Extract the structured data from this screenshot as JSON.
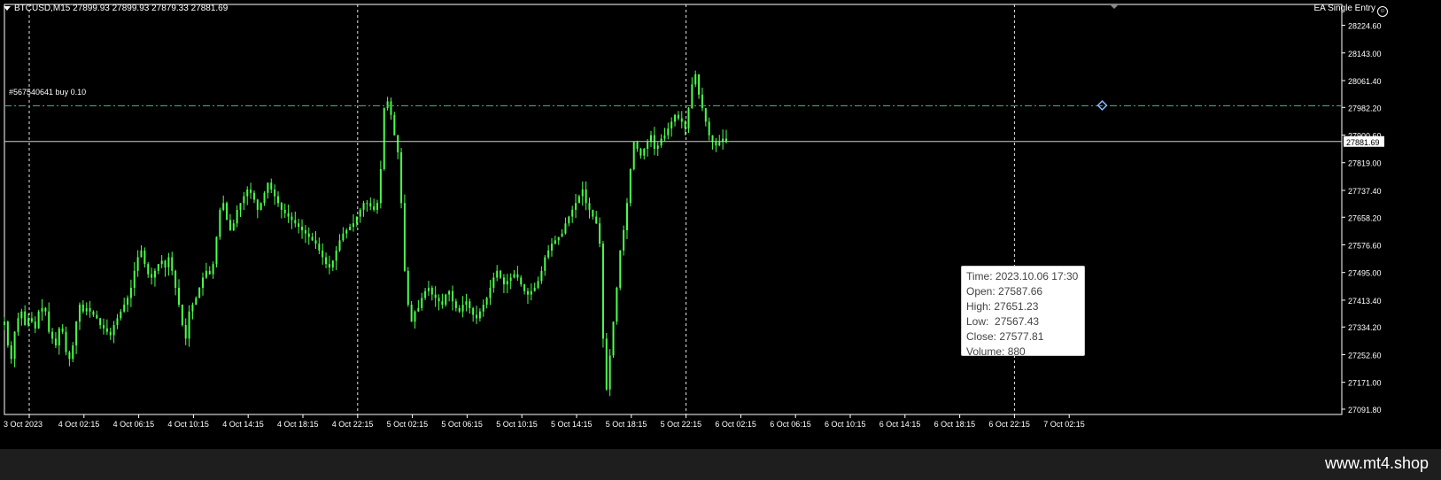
{
  "header": {
    "symbol_line": "BTCUSD,M15  27899.93 27899.93 27879.33 27881.69",
    "expert_label": "EA Single Entry"
  },
  "order_line": {
    "label": "#567540641 buy 0.10",
    "price": 27987
  },
  "current_price": {
    "label": "27881.69",
    "value": 27881.69
  },
  "tooltip": {
    "time": "Time: 2023.10.06 17:30",
    "open": "Open: 27587.66",
    "high": "High: 27651.23",
    "low": "Low:  27567.43",
    "close": "Close: 27577.81",
    "volume": "Volume: 880"
  },
  "footer": {
    "watermark": "www.mt4.shop"
  },
  "colors": {
    "background": "#000000",
    "candle": "#4cff4c",
    "grid": "#ffffff",
    "order_line": "#3cb371",
    "axis_text": "#ffffff"
  },
  "chart_data": {
    "type": "candlestick",
    "symbol": "BTCUSD",
    "timeframe": "M15",
    "ylim": [
      27091.8,
      28260
    ],
    "y_ticks": [
      "28224.60",
      "28143.00",
      "28061.40",
      "27982.20",
      "27900.60",
      "27819.00",
      "27737.40",
      "27658.20",
      "27576.60",
      "27495.00",
      "27413.40",
      "27334.20",
      "27252.60",
      "27171.00",
      "27091.80"
    ],
    "x_ticks": [
      "3 Oct 2023",
      "4 Oct 02:15",
      "4 Oct 06:15",
      "4 Oct 10:15",
      "4 Oct 14:15",
      "4 Oct 18:15",
      "4 Oct 22:15",
      "5 Oct 02:15",
      "5 Oct 06:15",
      "5 Oct 10:15",
      "5 Oct 14:15",
      "5 Oct 18:15",
      "5 Oct 22:15",
      "6 Oct 02:15",
      "6 Oct 06:15",
      "6 Oct 10:15",
      "6 Oct 14:15",
      "6 Oct 18:15",
      "6 Oct 22:15",
      "7 Oct 02:15"
    ],
    "bars_per_tick": 16,
    "closes": [
      27350,
      27280,
      27240,
      27320,
      27360,
      27380,
      27340,
      27360,
      27350,
      27330,
      27380,
      27390,
      27380,
      27320,
      27300,
      27280,
      27330,
      27320,
      27260,
      27240,
      27280,
      27350,
      27400,
      27380,
      27390,
      27380,
      27370,
      27360,
      27340,
      27330,
      27320,
      27310,
      27340,
      27360,
      27380,
      27400,
      27420,
      27450,
      27500,
      27540,
      27560,
      27520,
      27490,
      27480,
      27500,
      27520,
      27530,
      27510,
      27540,
      27500,
      27450,
      27400,
      27340,
      27300,
      27380,
      27400,
      27420,
      27450,
      27480,
      27500,
      27490,
      27520,
      27600,
      27680,
      27700,
      27650,
      27620,
      27640,
      27680,
      27700,
      27720,
      27740,
      27730,
      27710,
      27680,
      27700,
      27730,
      27760,
      27740,
      27720,
      27700,
      27680,
      27670,
      27660,
      27650,
      27640,
      27630,
      27620,
      27610,
      27600,
      27590,
      27580,
      27560,
      27540,
      27520,
      27510,
      27530,
      27560,
      27590,
      27610,
      27620,
      27630,
      27640,
      27660,
      27680,
      27700,
      27700,
      27690,
      27680,
      27700,
      27800,
      27980,
      28000,
      27960,
      27900,
      27850,
      27700,
      27500,
      27400,
      27350,
      27380,
      27390,
      27420,
      27440,
      27450,
      27430,
      27420,
      27410,
      27400,
      27430,
      27440,
      27410,
      27390,
      27380,
      27400,
      27410,
      27390,
      27370,
      27360,
      27380,
      27400,
      27420,
      27450,
      27480,
      27500,
      27480,
      27460,
      27470,
      27480,
      27490,
      27480,
      27460,
      27440,
      27430,
      27440,
      27450,
      27470,
      27500,
      27540,
      27560,
      27580,
      27590,
      27600,
      27610,
      27640,
      27660,
      27680,
      27700,
      27720,
      27740,
      27700,
      27680,
      27660,
      27640,
      27580,
      27300,
      27150,
      27250,
      27350,
      27450,
      27560,
      27620,
      27700,
      27800,
      27880,
      27860,
      27840,
      27860,
      27880,
      27900,
      27860,
      27870,
      27890,
      27900,
      27920,
      27940,
      27960,
      27950,
      27940,
      27920,
      27980,
      28050,
      28080,
      28020,
      27980,
      27940,
      27900,
      27880,
      27870,
      27880,
      27890,
      27882
    ],
    "tooltip_bar": {
      "time": "2023.10.06 17:30",
      "open": 27587.66,
      "high": 27651.23,
      "low": 27567.43,
      "close": 27577.81,
      "volume": 880
    }
  }
}
